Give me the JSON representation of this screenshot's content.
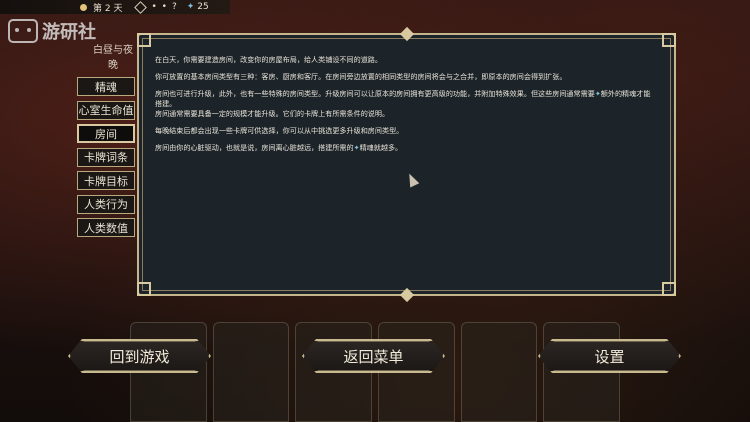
{
  "topbar": {
    "day": "第 2 天",
    "dots": "• •",
    "question": "?",
    "star_count": "25"
  },
  "logo": {
    "text": "游研社"
  },
  "sidebar": {
    "title": "白昼与夜晚",
    "items": [
      {
        "label": "精魂"
      },
      {
        "label": "心室生命值"
      },
      {
        "label": "房间"
      },
      {
        "label": "卡牌词条"
      },
      {
        "label": "卡牌目标"
      },
      {
        "label": "人类行为"
      },
      {
        "label": "人类数值"
      }
    ],
    "active_index": 2
  },
  "panel": {
    "p1": "在白天，你需要建造房间，改变你的房屋布局，给人类铺设不同的道路。",
    "p2": "你可放置的基本房间类型有三种：客房、厨房和客厅。在房间旁边放置的相同类型的房间将会与之合并，即原本的房间会得到扩张。",
    "p3a": "房间也可进行升级，此外，也有一些特殊的房间类型。升级房间可以让原本的房间拥有更高级的功能，并附加特殊效果。但这些房间通常需要",
    "p3b": "额外的精魂才能搭建。",
    "p4": "房间通常需要具备一定的规模才能升级。它们的卡牌上有所需条件的说明。",
    "p5": "每晚结束后都会出现一些卡牌可供选择，你可以从中挑选更多升级和房间类型。",
    "p6a": "房间由你的心脏驱动，也就是说，房间离心脏越远，搭建所需的",
    "p6b": "精魂就越多。",
    "gem_glyph": "✦"
  },
  "buttons": {
    "back_to_game": "回到游戏",
    "back_to_menu": "返回菜单",
    "settings": "设置"
  },
  "colors": {
    "accent": "#c8b98f",
    "panel_bg": "#1d2429",
    "gem": "#7fc0e0"
  }
}
